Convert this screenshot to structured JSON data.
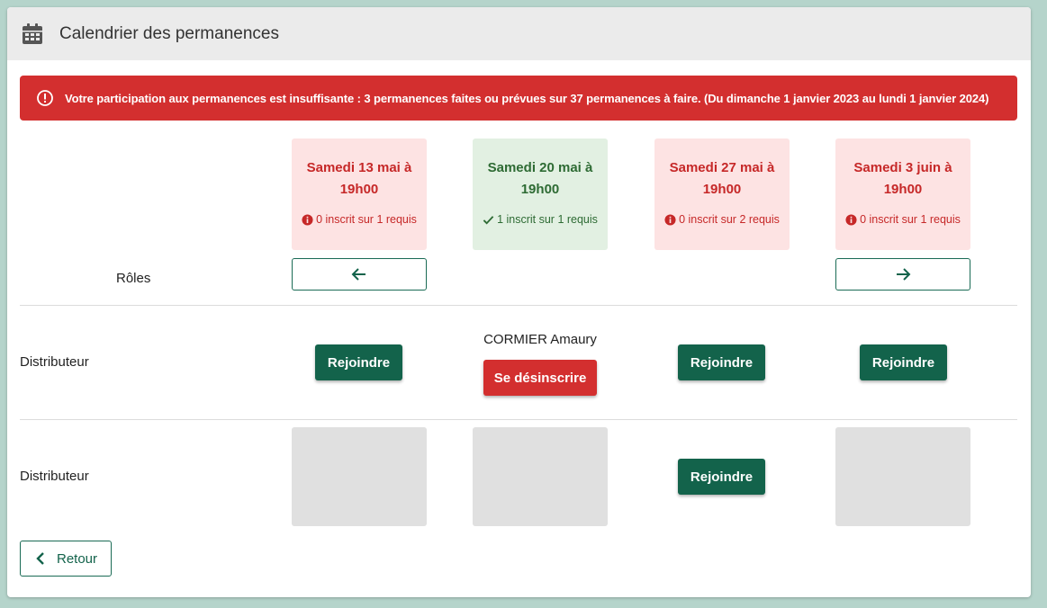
{
  "header": {
    "title": "Calendrier des permanences",
    "icon": "calendar-icon"
  },
  "alert": {
    "text": "Votre participation aux permanences est insuffisante : 3 permanences faites ou prévues sur 37 permanences à faire. (Du dimanche 1 janvier 2023 au lundi 1 janvier 2024)",
    "color": "#d32f2f"
  },
  "roles_label": "Rôles",
  "shifts": [
    {
      "title": "Samedi 13 mai à 19h00",
      "status": "0 inscrit sur 1 requis",
      "state": "insufficient"
    },
    {
      "title": "Samedi 20 mai à 19h00",
      "status": "1 inscrit sur 1 requis",
      "state": "complete"
    },
    {
      "title": "Samedi 27 mai à 19h00",
      "status": "0 inscrit sur 2 requis",
      "state": "insufficient"
    },
    {
      "title": "Samedi 3 juin à 19h00",
      "status": "0 inscrit sur 1 requis",
      "state": "insufficient"
    }
  ],
  "rows": [
    {
      "role": "Distributeur",
      "join_label": "Rejoindre",
      "member": "CORMIER Amaury",
      "unsubscribe_label": "Se désinscrire"
    },
    {
      "role": "Distributeur",
      "join_label": "Rejoindre"
    }
  ],
  "back_label": "Retour",
  "colors": {
    "primary": "#13634b",
    "danger": "#d32f2f",
    "insufficient_bg": "#fde3e3",
    "complete_bg": "#e2f0e2",
    "background": "#b5d4cb"
  }
}
